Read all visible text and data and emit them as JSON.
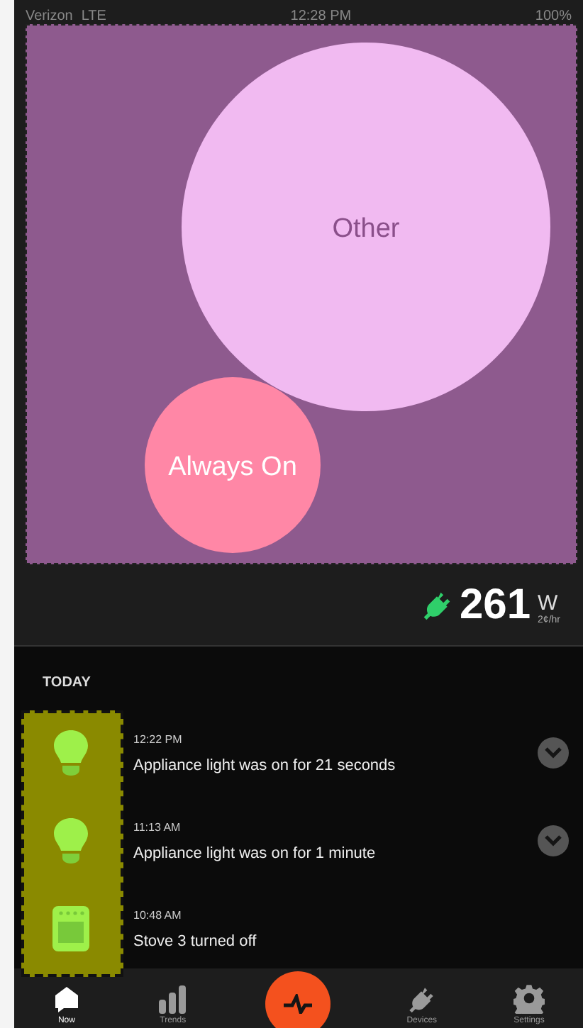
{
  "status_bar": {
    "carrier": "Verizon",
    "network": "LTE",
    "time": "12:28 PM",
    "battery": "100%"
  },
  "bubbles": [
    {
      "label": "Other",
      "color": "#f1baf1"
    },
    {
      "label": "Always On",
      "color": "#ff87a6"
    }
  ],
  "power": {
    "value": "261",
    "unit": "W",
    "rate": "2¢/hr"
  },
  "section": "TODAY",
  "events": [
    {
      "kind": "bulb",
      "time": "12:22 PM",
      "text": "Appliance light was on for 21 seconds",
      "expandable": true
    },
    {
      "kind": "bulb",
      "time": "11:13 AM",
      "text": "Appliance light was on for 1 minute",
      "expandable": true
    },
    {
      "kind": "stove",
      "time": "10:48 AM",
      "text": "Stove 3 turned off",
      "expandable": false
    }
  ],
  "tabs": [
    {
      "kind": "now",
      "label": "Now",
      "selected": true
    },
    {
      "kind": "trends",
      "label": "Trends",
      "selected": false
    },
    {
      "kind": "pulse",
      "selected": false
    },
    {
      "kind": "devices",
      "label": "Devices",
      "selected": false
    },
    {
      "kind": "settings",
      "label": "Settings",
      "selected": false
    }
  ]
}
